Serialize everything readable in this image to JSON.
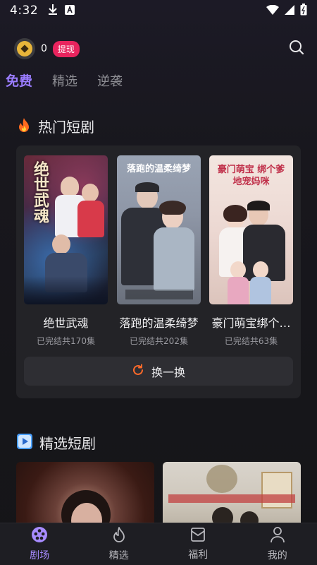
{
  "status_bar": {
    "time": "4:32"
  },
  "top_bar": {
    "coin_count": "0",
    "withdraw_label": "提现"
  },
  "tabs": [
    {
      "label": "免费",
      "active": true
    },
    {
      "label": "精选",
      "active": false
    },
    {
      "label": "逆袭",
      "active": false
    }
  ],
  "hot_section": {
    "title": "热门短剧",
    "dramas": [
      {
        "title": "绝世武魂",
        "status": "已完结共170集",
        "poster_text": "绝世武魂"
      },
      {
        "title": "落跑的温柔绮梦",
        "status": "已完结共202集",
        "poster_text": "落跑的温柔绮梦"
      },
      {
        "title": "豪门萌宝绑个…",
        "status": "已完结共63集",
        "poster_text": "豪门萌宝 绑个爹地宠妈咪"
      }
    ],
    "refresh_label": "换一换"
  },
  "featured_section": {
    "title": "精选短剧"
  },
  "bottom_nav": [
    {
      "label": "剧场",
      "icon": "theater-icon",
      "active": true
    },
    {
      "label": "精选",
      "icon": "flame-icon",
      "active": false
    },
    {
      "label": "福利",
      "icon": "gift-icon",
      "active": false
    },
    {
      "label": "我的",
      "icon": "person-icon",
      "active": false
    }
  ],
  "colors": {
    "accent": "#9a7cff",
    "withdraw": "#e8245e",
    "refresh_icon": "#ff6a2a"
  }
}
